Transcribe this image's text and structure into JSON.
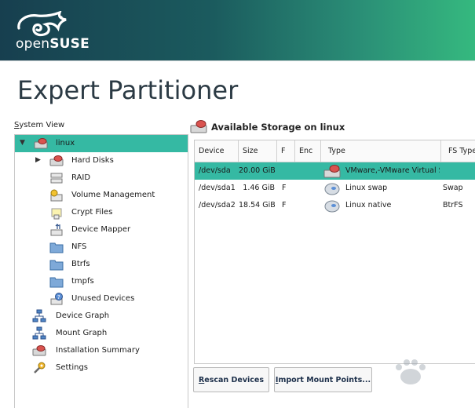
{
  "header": {
    "logo_text_light": "open",
    "logo_text_bold": "SUSE"
  },
  "page": {
    "title": "Expert Partitioner"
  },
  "sidebar": {
    "label_first": "S",
    "label_rest": "ystem View",
    "items": [
      {
        "label": "linux",
        "icon": "hard-disk-icon",
        "selected": true
      },
      {
        "label": "Hard Disks",
        "icon": "hard-disk-icon"
      },
      {
        "label": "RAID",
        "icon": "raid-icon"
      },
      {
        "label": "Volume Management",
        "icon": "volume-management-icon"
      },
      {
        "label": "Crypt Files",
        "icon": "crypt-files-icon"
      },
      {
        "label": "Device Mapper",
        "icon": "device-mapper-icon"
      },
      {
        "label": "NFS",
        "icon": "nfs-folder-icon"
      },
      {
        "label": "Btrfs",
        "icon": "btrfs-folder-icon"
      },
      {
        "label": "tmpfs",
        "icon": "tmpfs-folder-icon"
      },
      {
        "label": "Unused Devices",
        "icon": "unused-devices-icon"
      },
      {
        "label": "Device Graph",
        "icon": "device-graph-icon"
      },
      {
        "label": "Mount Graph",
        "icon": "mount-graph-icon"
      },
      {
        "label": "Installation Summary",
        "icon": "installation-summary-icon"
      },
      {
        "label": "Settings",
        "icon": "settings-icon"
      }
    ]
  },
  "main": {
    "title": "Available Storage on linux",
    "columns": [
      "Device",
      "Size",
      "F",
      "Enc",
      "Type",
      "FS Type"
    ],
    "rows": [
      {
        "device": "/dev/sda",
        "size": "20.00 GiB",
        "f": "",
        "enc": "",
        "type": "VMware,-VMware Virtual S",
        "fs_type": "",
        "icon": "hard-disk-icon",
        "selected": true
      },
      {
        "device": "/dev/sda1",
        "size": "1.46 GiB",
        "f": "F",
        "enc": "",
        "type": "Linux swap",
        "fs_type": "Swap",
        "icon": "partition-icon"
      },
      {
        "device": "/dev/sda2",
        "size": "18.54 GiB",
        "f": "F",
        "enc": "",
        "type": "Linux native",
        "fs_type": "BtrFS",
        "icon": "partition-icon"
      }
    ]
  },
  "buttons": {
    "rescan_first": "R",
    "rescan_rest": "escan Devices",
    "import_first": "I",
    "import_rest": "mport Mount Points..."
  },
  "colors": {
    "accent": "#35b9a3",
    "header_start": "#173f4f",
    "header_end": "#35b97f"
  }
}
